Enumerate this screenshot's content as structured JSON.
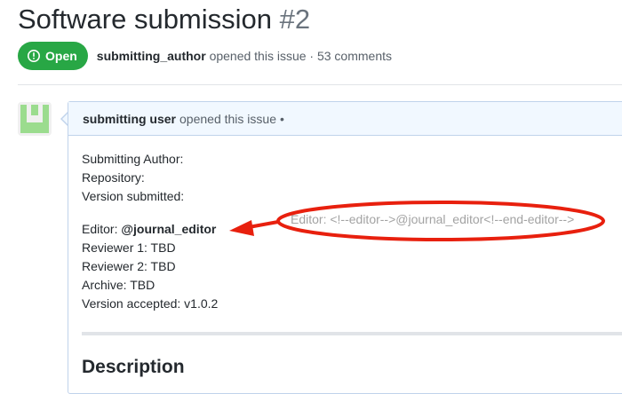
{
  "issue": {
    "title": "Software submission",
    "number": "#2",
    "state_label": "Open",
    "author": "submitting_author",
    "opened_text": "opened this issue",
    "comment_count_text": "· 53 comments"
  },
  "comment": {
    "author": "submitting user",
    "header_text": "opened this issue",
    "header_dot": "•",
    "fields": {
      "submitting_author": "Submitting Author:",
      "repository": "Repository:",
      "version_submitted": "Version submitted:",
      "editor_label": "Editor:",
      "editor_value": "@journal_editor",
      "reviewer1": "Reviewer 1: TBD",
      "reviewer2": "Reviewer 2: TBD",
      "archive": "Archive: TBD",
      "version_accepted": "Version accepted: v1.0.2"
    },
    "description_heading": "Description"
  },
  "annotation": {
    "callout_text": "Editor: <!--editor-->@journal_editor<!--end-editor-->",
    "color": "#e8200e"
  },
  "colors": {
    "open_badge": "#28a745",
    "header_bg": "#f1f8ff",
    "header_border": "#c0d3eb",
    "avatar_green": "#9bdc8e"
  }
}
